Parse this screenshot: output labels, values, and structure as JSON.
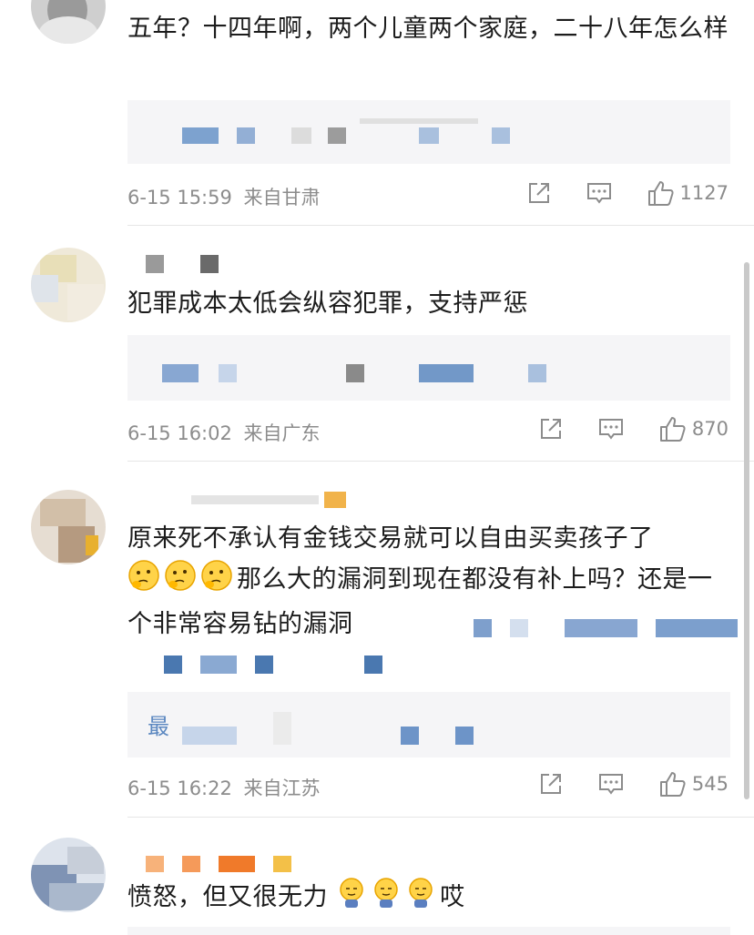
{
  "comments": [
    {
      "text": "五年？十四年啊，两个儿童两个家庭，二十八年怎么样",
      "date": "6-15 15:59",
      "location": "来自甘肃",
      "likes": "1127"
    },
    {
      "text": "犯罪成本太低会纵容犯罪，支持严惩",
      "date": "6-15 16:02",
      "location": "来自广东",
      "likes": "870"
    },
    {
      "text_part1": "原来死不承认有金钱交易就可以自由买卖孩子了",
      "text_part2": "那么大的漏洞到现在都没有补上吗？还是一个非常容易钻的漏洞",
      "reply_preview": "最",
      "date": "6-15 16:22",
      "location": "来自江苏",
      "likes": "545"
    },
    {
      "text": "愤怒，但又很无力",
      "text_end": "哎"
    }
  ],
  "colors": {
    "meta": "#8c8c8c",
    "reply_bg": "#f5f5f7",
    "blurred_link": "#4a78b0"
  },
  "icons": [
    "share-icon",
    "comment-icon",
    "like-icon",
    "thinking-emoji",
    "sweat-emoji"
  ]
}
